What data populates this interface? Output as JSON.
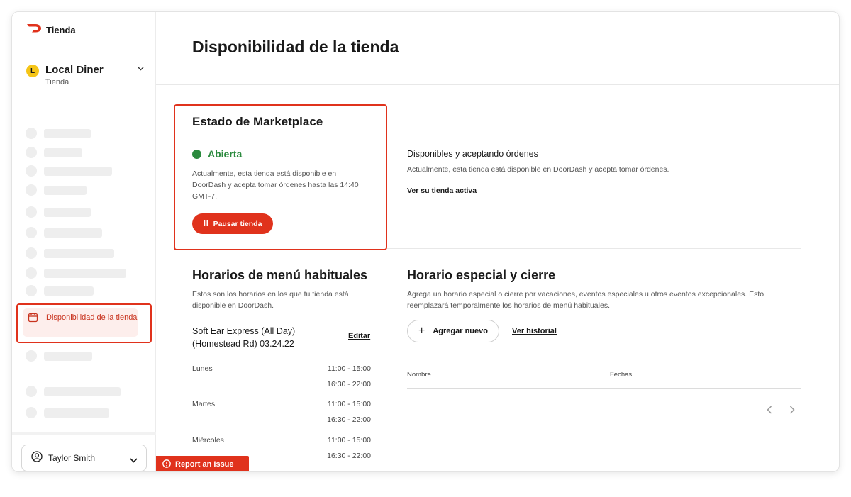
{
  "brand": {
    "name": "Tienda",
    "accent": "#e0321c"
  },
  "store": {
    "initial": "L",
    "name": "Local Diner",
    "subtitle": "Tienda"
  },
  "sidebar": {
    "active_item": {
      "label": "Disponibilidad de la tienda",
      "icon": "calendar-icon"
    }
  },
  "user": {
    "name": "Taylor Smith"
  },
  "page": {
    "title": "Disponibilidad de la tienda"
  },
  "marketplace": {
    "title": "Estado de Marketplace",
    "status": "Abierta",
    "status_color": "#2b8a3e",
    "description": "Actualmente, esta tienda está disponible en DoorDash y acepta tomar órdenes hasta las 14:40 GMT-7.",
    "pause_label": "Pausar tienda"
  },
  "availability": {
    "title": "Disponibles y aceptando órdenes",
    "description": "Actualmente, esta tienda está disponible en DoorDash y acepta tomar órdenes.",
    "link": "Ver su tienda activa"
  },
  "regular_hours": {
    "title": "Horarios de menú habituales",
    "description": "Estos son los horarios en los que tu tienda está disponible en DoorDash.",
    "menu_name": "Soft Ear Express (All Day) (Homestead Rd) 03.24.22",
    "edit_label": "Editar",
    "days": [
      {
        "day": "Lunes",
        "slots": [
          "11:00 - 15:00",
          "16:30 - 22:00"
        ]
      },
      {
        "day": "Martes",
        "slots": [
          "11:00 - 15:00",
          "16:30 - 22:00"
        ]
      },
      {
        "day": "Miércoles",
        "slots": [
          "11:00 - 15:00",
          "16:30 - 22:00"
        ]
      }
    ]
  },
  "special_hours": {
    "title": "Horario especial y cierre",
    "description": "Agrega un horario especial o cierre por vacaciones, eventos especiales u otros eventos excepcionales. Esto reemplazará temporalmente los horarios de menú habituales.",
    "add_label": "Agregar nuevo",
    "history_label": "Ver historial",
    "columns": [
      "Nombre",
      "Fechas"
    ]
  },
  "report": {
    "label": "Report an Issue"
  }
}
